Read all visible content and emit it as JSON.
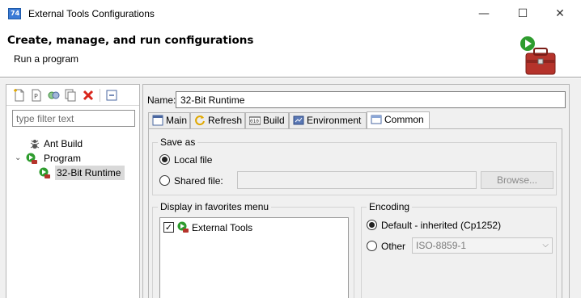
{
  "window": {
    "title": "External Tools Configurations",
    "minimize_glyph": "—",
    "maximize_glyph": "☐",
    "close_glyph": "✕"
  },
  "header": {
    "title": "Create, manage, and run configurations",
    "message": "Run a program"
  },
  "sidebar": {
    "filter_placeholder": "type filter text",
    "filter_value": "",
    "toolbar_icons": [
      "new-config-icon",
      "new-prototype-icon",
      "link-icon",
      "duplicate-icon",
      "delete-icon",
      "collapse-all-icon"
    ],
    "tree": [
      {
        "label": "Ant Build",
        "icon": "ant-icon",
        "level": 1,
        "selected": false
      },
      {
        "label": "Program",
        "icon": "program-icon",
        "level": 1,
        "expanded": true,
        "selected": false
      },
      {
        "label": "32-Bit Runtime",
        "icon": "runtime-config-icon",
        "level": 2,
        "selected": true
      }
    ]
  },
  "editor": {
    "name_label": "Name:",
    "name_value": "32-Bit Runtime",
    "tabs": [
      {
        "label": "Main",
        "icon": "main-tab-icon",
        "active": false
      },
      {
        "label": "Refresh",
        "icon": "refresh-icon",
        "active": false
      },
      {
        "label": "Build",
        "icon": "build-icon",
        "active": false
      },
      {
        "label": "Environment",
        "icon": "environment-icon",
        "active": false
      },
      {
        "label": "Common",
        "icon": "common-icon",
        "active": true
      }
    ],
    "save_as": {
      "title": "Save as",
      "local_label": "Local file",
      "local_selected": true,
      "shared_label": "Shared file:",
      "shared_value": "",
      "browse_label": "Browse..."
    },
    "favorites": {
      "title": "Display in favorites menu",
      "items": [
        {
          "label": "External Tools",
          "checked": true
        }
      ]
    },
    "encoding": {
      "title": "Encoding",
      "default_label": "Default - inherited (Cp1252)",
      "default_selected": true,
      "other_label": "Other",
      "other_value": "ISO-8859-1"
    }
  },
  "colors": {
    "accent_blue": "#3b7bd6",
    "delete_red": "#d9261c",
    "run_green": "#2e9c2e",
    "toolbox_red": "#b5332b"
  }
}
